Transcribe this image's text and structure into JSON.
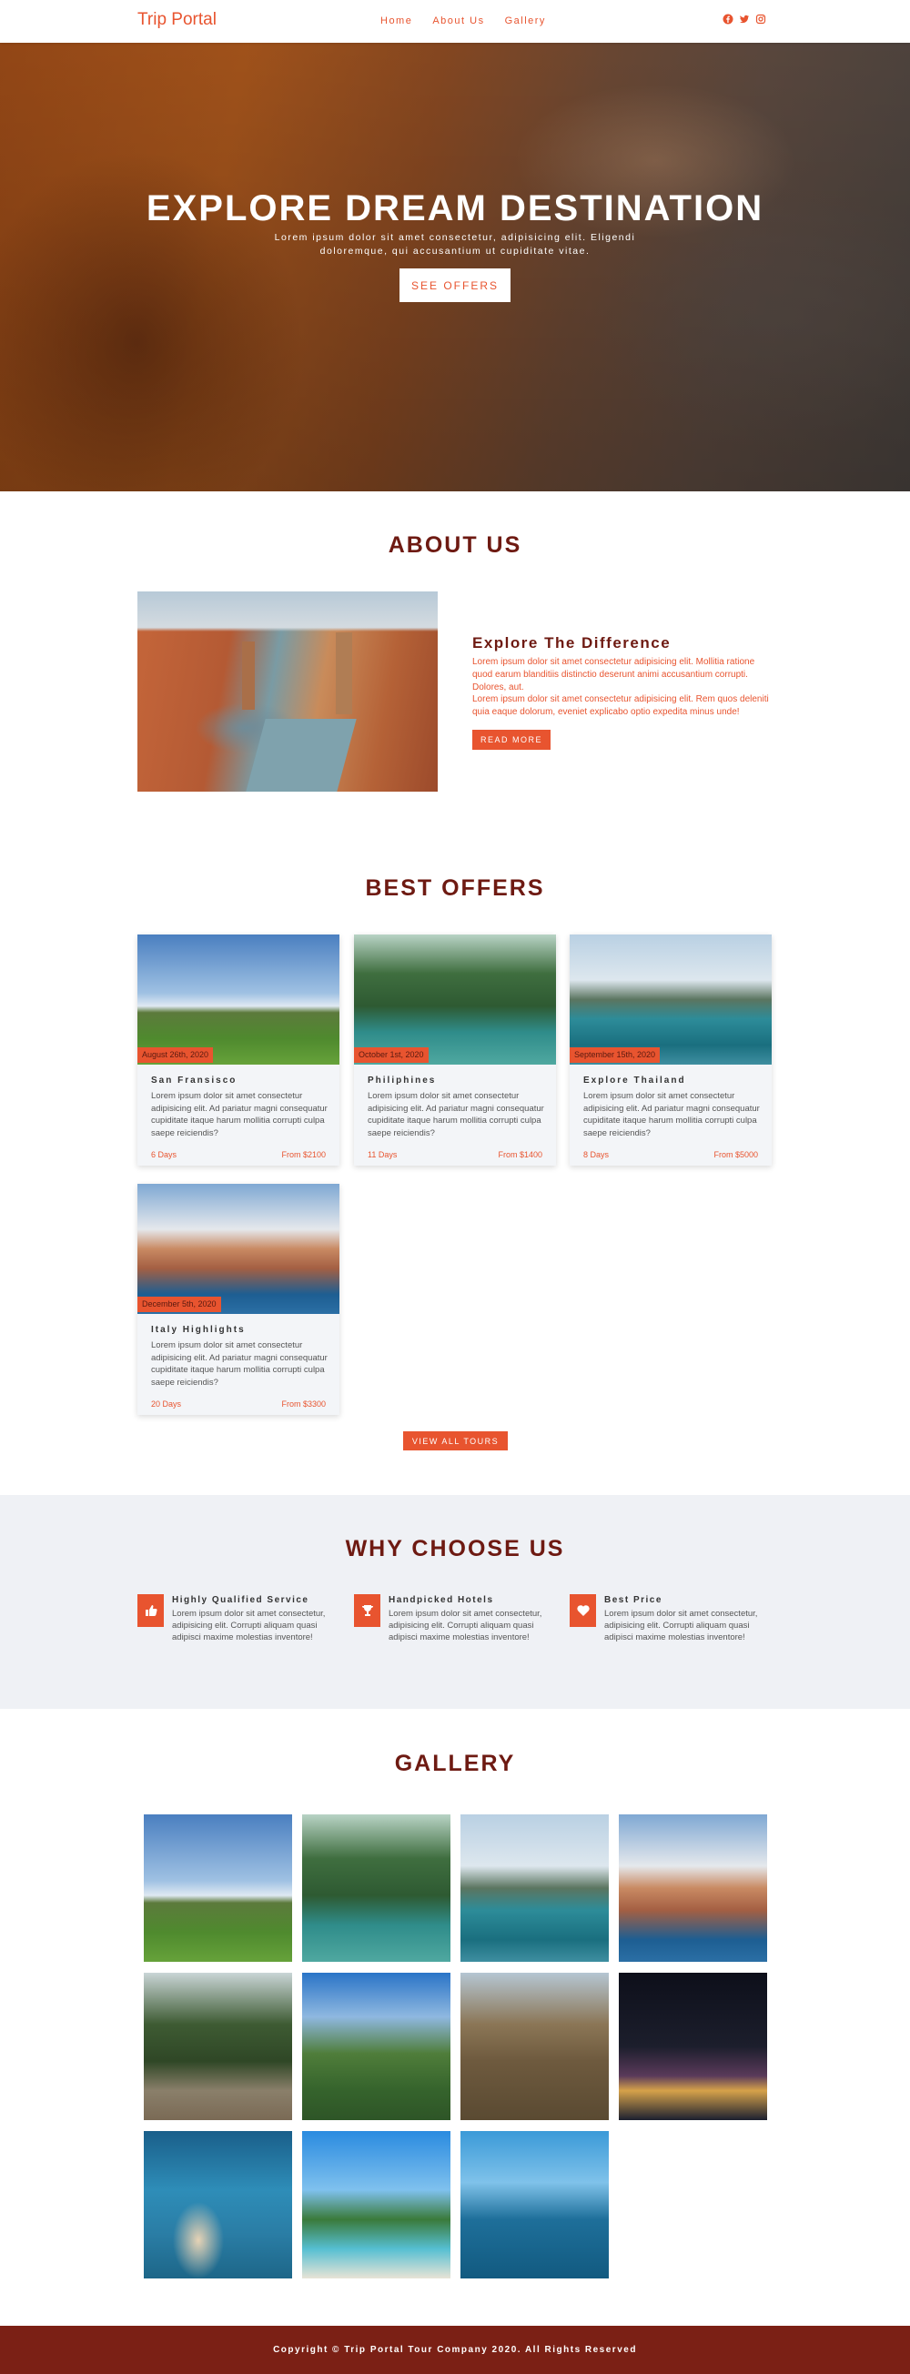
{
  "nav": {
    "brand": "Trip Portal",
    "links": [
      "Home",
      "About Us",
      "Gallery"
    ],
    "social_icons": [
      "facebook-icon",
      "twitter-icon",
      "instagram-icon"
    ]
  },
  "hero": {
    "title": "EXPLORE DREAM DESTINATION",
    "subtitle": "Lorem ipsum dolor sit amet consectetur, adipisicing elit. Eligendi doloremque, qui accusantium ut cupiditate vitae.",
    "button": "SEE OFFERS"
  },
  "about": {
    "section_title": "ABOUT US",
    "heading": "Explore The Difference",
    "para1": "Lorem ipsum dolor sit amet consectetur adipisicing elit. Mollitia ratione quod earum blanditiis distinctio deserunt animi accusantium corrupti. Dolores, aut.",
    "para2": "Lorem ipsum dolor sit amet consectetur adipisicing elit. Rem quos deleniti quia eaque dolorum, eveniet explicabo optio expedita minus unde!",
    "button": "READ MORE"
  },
  "offers": {
    "section_title": "BEST OFFERS",
    "cards": [
      {
        "date": "August 26th, 2020",
        "title": "San Fransisco",
        "desc": "Lorem ipsum dolor sit amet consectetur adipisicing elit. Ad pariatur magni consequatur cupiditate itaque harum mollitia corrupti culpa saepe reiciendis?",
        "days": "6 Days",
        "price": "From $2100"
      },
      {
        "date": "October 1st, 2020",
        "title": "Philiphines",
        "desc": "Lorem ipsum dolor sit amet consectetur adipisicing elit. Ad pariatur magni consequatur cupiditate itaque harum mollitia corrupti culpa saepe reiciendis?",
        "days": "11 Days",
        "price": "From $1400"
      },
      {
        "date": "September 15th, 2020",
        "title": "Explore Thailand",
        "desc": "Lorem ipsum dolor sit amet consectetur adipisicing elit. Ad pariatur magni consequatur cupiditate itaque harum mollitia corrupti culpa saepe reiciendis?",
        "days": "8 Days",
        "price": "From $5000"
      },
      {
        "date": "December 5th, 2020",
        "title": "Italy Highlights",
        "desc": "Lorem ipsum dolor sit amet consectetur adipisicing elit. Ad pariatur magni consequatur cupiditate itaque harum mollitia corrupti culpa saepe reiciendis?",
        "days": "20 Days",
        "price": "From $3300"
      }
    ],
    "button": "VIEW ALL TOURS"
  },
  "why": {
    "section_title": "WHY CHOOSE US",
    "items": [
      {
        "icon": "thumbs-up-icon",
        "title": "Highly Qualified Service",
        "desc": "Lorem ipsum dolor sit amet consectetur, adipisicing elit. Corrupti aliquam quasi adipisci maxime molestias inventore!"
      },
      {
        "icon": "trophy-icon",
        "title": "Handpicked Hotels",
        "desc": "Lorem ipsum dolor sit amet consectetur, adipisicing elit. Corrupti aliquam quasi adipisci maxime molestias inventore!"
      },
      {
        "icon": "heart-icon",
        "title": "Best Price",
        "desc": "Lorem ipsum dolor sit amet consectetur, adipisicing elit. Corrupti aliquam quasi adipisci maxime molestias inventore!"
      }
    ]
  },
  "gallery": {
    "section_title": "GALLERY"
  },
  "footer": {
    "text": "Copyright © Trip Portal Tour Company 2020. All Rights Reserved"
  },
  "colors": {
    "accent": "#e8542f",
    "heading": "#6e1a12",
    "footer": "#7b2015",
    "why_bg": "#eff1f5"
  }
}
